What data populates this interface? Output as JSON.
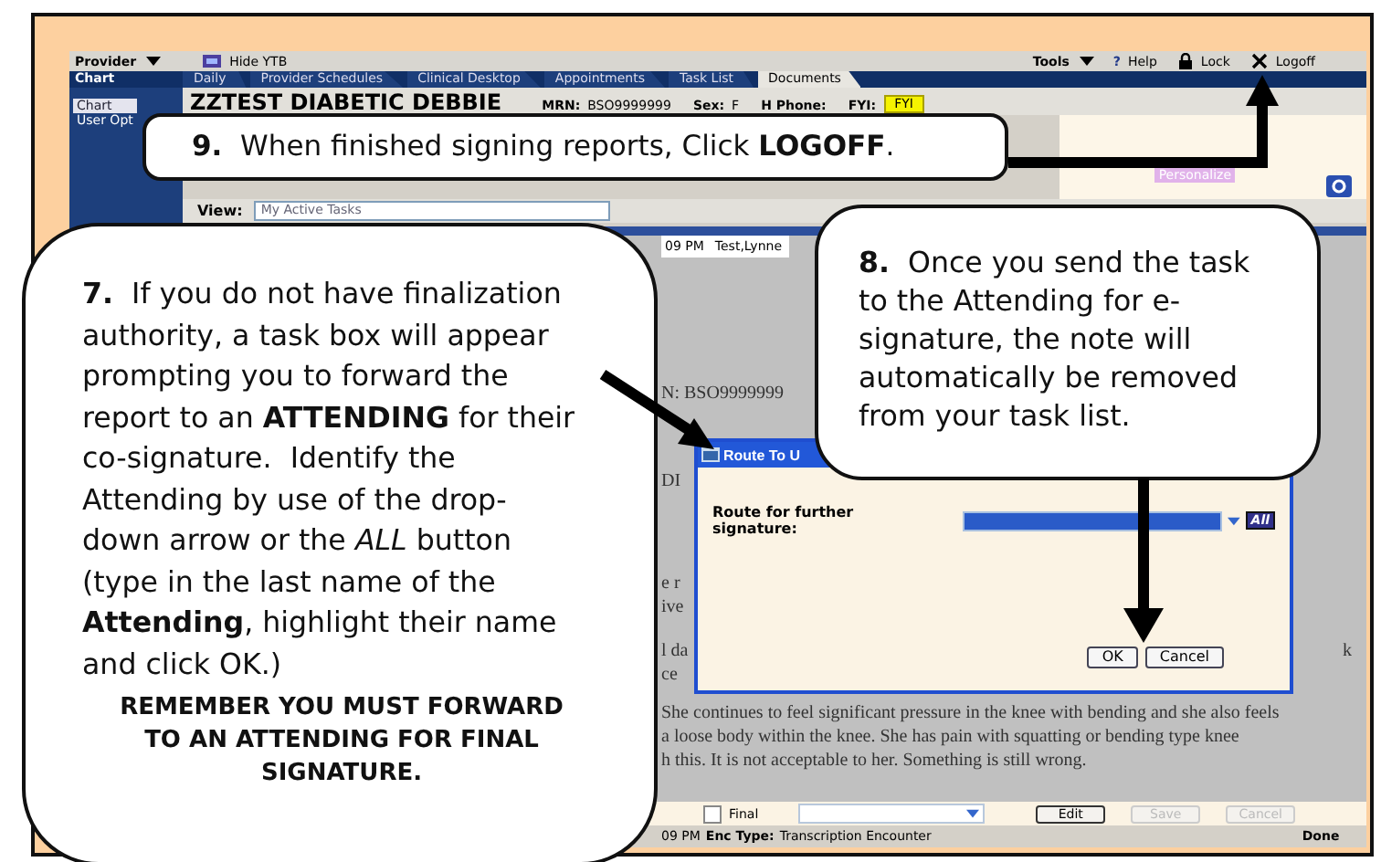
{
  "top_bar": {
    "menu": "Provider",
    "hide_link": "Hide YTB",
    "tools": "Tools",
    "help_mark": "?",
    "help": "Help",
    "lock": "Lock",
    "logoff": "Logoff"
  },
  "nav": {
    "title": "Chart",
    "tabs": [
      {
        "label": "Daily",
        "selected": false
      },
      {
        "label": "Provider Schedules",
        "selected": false
      },
      {
        "label": "Clinical Desktop",
        "selected": false
      },
      {
        "label": "Appointments",
        "selected": false
      },
      {
        "label": "Task List",
        "selected": false
      },
      {
        "label": "Documents",
        "selected": true
      }
    ]
  },
  "sidebar": {
    "items": [
      {
        "label": "Chart",
        "selected": true
      },
      {
        "label": "User Opt",
        "selected": false
      }
    ]
  },
  "patient": {
    "name": "ZZTEST DIABETIC DEBBIE",
    "fields": [
      {
        "label": "MRN:",
        "value": "BSO9999999"
      },
      {
        "label": "Sex:",
        "value": "F"
      },
      {
        "label": "H Phone:"
      },
      {
        "label": "FYI:",
        "badge": "FYI"
      }
    ]
  },
  "tasks": {
    "personalize": "Personalize",
    "view_label": "View:",
    "view_value": "My Active Tasks",
    "rows": [
      {
        "time": "09 PM",
        "name": "Test,Lynne"
      }
    ]
  },
  "document": {
    "lines": [
      {
        "text": "N:  BSO9999999"
      },
      {
        "text": "DI"
      },
      {
        "text": "e r"
      },
      {
        "text": "ive"
      },
      {
        "text": "l da",
        "end": "k"
      },
      {
        "text": "ce"
      },
      {
        "text": "She continues to feel significant pressure in the knee with bending and she also feels"
      },
      {
        "text": "a loose body within the knee.  She has pain with squatting or bending type knee"
      },
      {
        "text": "h this.  It is not acceptable to her.  Something is still wrong."
      }
    ]
  },
  "toolbar": {
    "final": {
      "label": "Final",
      "checked": false
    },
    "buttons": [
      {
        "label": "Edit",
        "disabled": false
      },
      {
        "label": "Save",
        "disabled": true
      },
      {
        "label": "Cancel",
        "disabled": true
      }
    ]
  },
  "status_bar": {
    "time": "09 PM",
    "enc_label": "Enc Type:",
    "enc_value": "Transcription Encounter",
    "state": "Done"
  },
  "dialog": {
    "title": "Route To U",
    "label": "Route for further signature:",
    "all_button": "All",
    "buttons": [
      "OK",
      "Cancel"
    ]
  },
  "callouts": [
    {
      "text": "**9.**  When finished signing reports, Click **LOGOFF**."
    },
    {
      "text": "**7.**  If you do not have finalization authority, a task box will appear prompting you to forward the report to an **ATTENDING** for their co-signature.  Identify the Attending by use of the drop-down arrow or the *ALL* button (type in the last name of the **Attending**, highlight their name and click OK.)",
      "note": "REMEMBER YOU MUST FORWARD TO AN ATTENDING FOR FINAL SIGNATURE."
    },
    {
      "text": "**8.**  Once you send the task to the Attending for e-signature, the note will automatically be removed from your task list."
    }
  ]
}
